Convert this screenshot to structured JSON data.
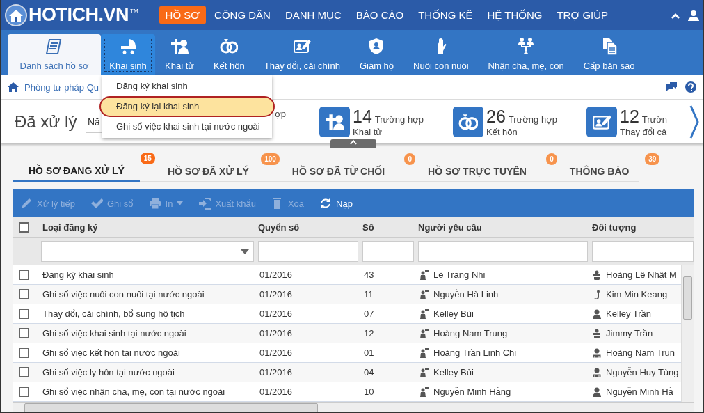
{
  "logo": {
    "text": "HOTICH.VN",
    "mark": "TM"
  },
  "main_menu": [
    {
      "label": "HỒ SƠ",
      "selected": true
    },
    {
      "label": "CÔNG DÂN",
      "selected": false
    },
    {
      "label": "DANH MỤC",
      "selected": false
    },
    {
      "label": "BÁO CÁO",
      "selected": false
    },
    {
      "label": "THỐNG KÊ",
      "selected": false
    },
    {
      "label": "HỆ THỐNG",
      "selected": false
    },
    {
      "label": "TRỢ GIÚP",
      "selected": false
    }
  ],
  "ribbon": [
    {
      "kind": "list",
      "label": "Danh sách hồ sơ",
      "selected": true,
      "expanded": false
    },
    {
      "kind": "stroller",
      "label": "Khai sinh",
      "selected": false,
      "expanded": true
    },
    {
      "kind": "death",
      "label": "Khai tử",
      "selected": false,
      "expanded": false
    },
    {
      "kind": "rings",
      "label": "Kết hôn",
      "selected": false,
      "expanded": false
    },
    {
      "kind": "edit",
      "label": "Thay đổi, cải chính",
      "selected": false,
      "expanded": false
    },
    {
      "kind": "shield",
      "label": "Giám hộ",
      "selected": false,
      "expanded": false
    },
    {
      "kind": "hand",
      "label": "Nuôi con nuôi",
      "selected": false,
      "expanded": false
    },
    {
      "kind": "family",
      "label": "Nhận cha, mẹ, con",
      "selected": false,
      "expanded": false
    },
    {
      "kind": "copy",
      "label": "Cấp bản sao",
      "selected": false,
      "expanded": false
    }
  ],
  "dropdown": [
    {
      "label": "Đăng ký khai sinh",
      "selected": false
    },
    {
      "label": "Đăng ký lại khai sinh",
      "selected": true
    },
    {
      "label": "Ghi sổ việc khai sinh tại nước ngoài",
      "selected": false
    }
  ],
  "breadcrumb": "Phòng tư pháp Qu",
  "summary": {
    "title": "Đã xử lý",
    "year_select": "Nă",
    "hidden_stat_tail": "ợp",
    "stats": [
      {
        "kind": "death",
        "count": "14",
        "unit": "Trường hợp",
        "label": "Khai tử"
      },
      {
        "kind": "rings",
        "count": "26",
        "unit": "Trường hợp",
        "label": "Kết hôn"
      },
      {
        "kind": "edit",
        "count": "12",
        "unit": "Trườn",
        "label": "Thay đổi cả"
      }
    ]
  },
  "tabs": [
    {
      "label": "HỒ SƠ ĐANG XỬ LÝ",
      "badge": "15",
      "selected": true
    },
    {
      "label": "HỒ SƠ ĐÃ XỬ LÝ",
      "badge": "100",
      "selected": false
    },
    {
      "label": "HỒ SƠ ĐÃ TỪ CHỐI",
      "badge": "0",
      "selected": false
    },
    {
      "label": "HỒ SƠ TRỰC TUYẾN",
      "badge": "0",
      "selected": false
    },
    {
      "label": "THÔNG BÁO",
      "badge": "39",
      "selected": false
    }
  ],
  "toolbar": [
    {
      "kind": "pencil",
      "label": "Xử lý tiếp",
      "disabled": true
    },
    {
      "kind": "check",
      "label": "Ghi sổ",
      "disabled": true
    },
    {
      "kind": "print",
      "label": "In",
      "disabled": true
    },
    {
      "kind": "export",
      "label": "Xuất khẩu",
      "disabled": true
    },
    {
      "kind": "trash",
      "label": "Xóa",
      "disabled": true
    },
    {
      "kind": "refresh",
      "label": "Nạp",
      "disabled": false
    }
  ],
  "table": {
    "all_checked": false,
    "columns": [
      "Loại đăng ký",
      "Quyển số",
      "Số",
      "Người yêu cầu",
      "Đối tượng"
    ],
    "rows": [
      {
        "checked": false,
        "type": "Đăng ký khai sinh",
        "book": "01/2016",
        "number": "43",
        "requester": "Lê Trang Nhi",
        "kind": "infant",
        "subject": "Hoàng Lê Nhật M"
      },
      {
        "checked": false,
        "type": "Ghi sổ việc nuôi con nuôi tại nước ngoài",
        "book": "01/2016",
        "number": "11",
        "requester": "Nguyễn Hà Linh",
        "kind": "child",
        "subject": "Kim Min Keang"
      },
      {
        "checked": false,
        "type": "Thay đổi, cải chính, bổ sung hộ tịch",
        "book": "01/2016",
        "number": "07",
        "requester": "Kelley Bùi",
        "kind": "person",
        "subject": "Kelley Trần"
      },
      {
        "checked": false,
        "type": "Ghi sổ việc khai sinh tại nước ngoài",
        "book": "01/2016",
        "number": "12",
        "requester": "Hoàng Nam Trung",
        "kind": "infant",
        "subject": "Jimmy Trần"
      },
      {
        "checked": false,
        "type": "Ghi sổ việc kết hôn tại nước ngoài",
        "book": "01/2016",
        "number": "01",
        "requester": "Hoàng Trần Linh Chi",
        "kind": "couple",
        "subject": "Hoàng Nam Trun"
      },
      {
        "checked": false,
        "type": "Ghi sổ việc ly hôn tại nước ngoài",
        "book": "01/2016",
        "number": "04",
        "requester": "Kelley Bùi",
        "kind": "couple",
        "subject": "Nguyễn Huy Tùng"
      },
      {
        "checked": false,
        "type": "Ghi sổ việc nhận cha, mẹ, con tại nước ngoài",
        "book": "01/2016",
        "number": "10",
        "requester": "Nguyễn Minh Hằng",
        "kind": "person",
        "subject": "Nguyễn Minh Hằ"
      }
    ]
  }
}
